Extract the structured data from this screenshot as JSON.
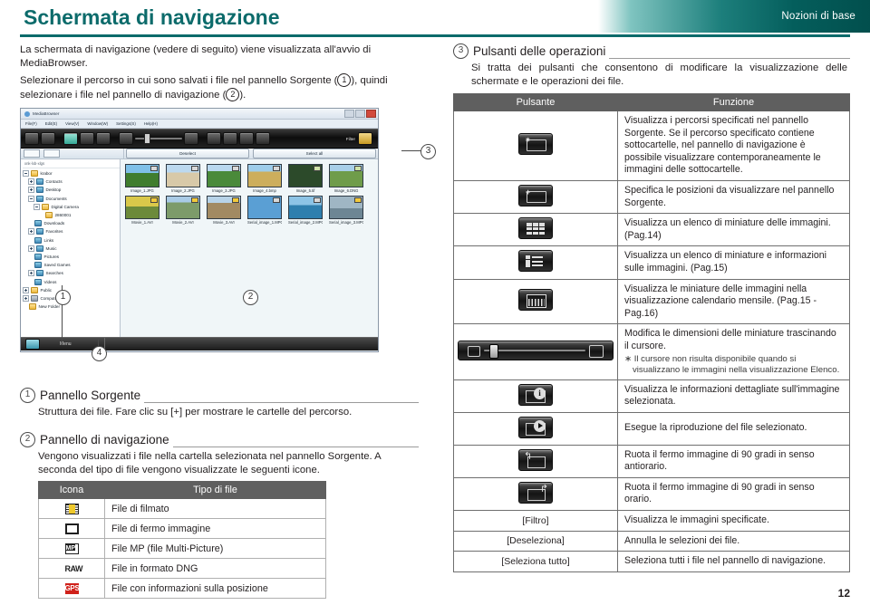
{
  "header": {
    "title": "Schermata di navigazione",
    "banner_label": "Nozioni di base"
  },
  "page_number": "12",
  "left": {
    "intro": {
      "p1": "La schermata di navigazione (vedere di seguito) viene visualizzata all'avvio di MediaBrowser.",
      "p2_a": "Selezionare il percorso in cui sono salvati i file nel pannello Sorgente (",
      "p2_mark1": "1",
      "p2_b": "), quindi selezionare i file nel pannello di navigazione (",
      "p2_mark2": "2",
      "p2_c": ")."
    },
    "callouts": {
      "one": "1",
      "two": "2",
      "three": "3",
      "four": "4"
    },
    "section1": {
      "num": "1",
      "title": "Pannello Sorgente",
      "body": "Struttura dei file. Fare clic su [+] per mostrare le cartelle del percorso."
    },
    "section2": {
      "num": "2",
      "title": "Pannello di navigazione",
      "body": "Vengono visualizzati i file nella cartella selezionata nel pannello Sorgente. A seconda del tipo di file vengono visualizzate le seguenti icone.",
      "table": {
        "headers": [
          "Icona",
          "Tipo di file"
        ],
        "rows": [
          {
            "icon": "movie-file-icon",
            "label": "File di filmato"
          },
          {
            "icon": "still-image-file-icon",
            "label": "File di fermo immagine"
          },
          {
            "icon": "mp-file-icon",
            "label": "File MP (file Multi-Picture)"
          },
          {
            "icon": "raw-dng-file-icon",
            "label": "File in formato DNG"
          },
          {
            "icon": "gps-file-icon",
            "label": "File con informazioni sulla posizione"
          }
        ]
      }
    }
  },
  "right": {
    "section3": {
      "num": "3",
      "title": "Pulsanti delle operazioni",
      "body": "Si tratta dei pulsanti che consentono di modificare la visualizzazione delle schermate e le operazioni dei file."
    },
    "table": {
      "headers": [
        "Pulsante",
        "Funzione"
      ],
      "rows": [
        {
          "button_kind": "icon",
          "button_icon": "folder-star-icon",
          "button_label": "",
          "function": "Visualizza i percorsi specificati nel pannello Sorgente. Se il percorso specificato contiene sottocartelle, nel pannello di navigazione è possibile visualizzare  contemporaneamente le immagini delle sottocartelle.",
          "note": ""
        },
        {
          "button_kind": "icon",
          "button_icon": "folder-plus-icon",
          "button_label": "",
          "function": "Specifica le posizioni da visualizzare nel pannello Sorgente.",
          "note": ""
        },
        {
          "button_kind": "icon",
          "button_icon": "thumbnail-grid-icon",
          "button_label": "",
          "function": "Visualizza un elenco di miniature delle immagini. (Pag.14)",
          "note": ""
        },
        {
          "button_kind": "icon",
          "button_icon": "thumbnail-list-icon",
          "button_label": "",
          "function": "Visualizza un elenco di miniature e informazioni sulle immagini. (Pag.15)",
          "note": ""
        },
        {
          "button_kind": "icon",
          "button_icon": "calendar-view-icon",
          "button_label": "",
          "function": "Visualizza le miniature delle immagini nella visualizzazione calendario mensile. (Pag.15 - Pag.16)",
          "note": ""
        },
        {
          "button_kind": "slider",
          "button_icon": "thumbnail-size-slider",
          "button_label": "",
          "function": "Modifica le dimensioni delle miniature trascinando il cursore.",
          "note": "∗ Il cursore non risulta disponibile quando si visualizzano le immagini nella visualizzazione Elenco."
        },
        {
          "button_kind": "icon",
          "button_icon": "image-info-icon",
          "button_label": "",
          "function": "Visualizza le informazioni dettagliate sull'immagine selezionata.",
          "note": ""
        },
        {
          "button_kind": "icon",
          "button_icon": "play-icon",
          "button_label": "",
          "function": "Esegue la riproduzione del file selezionato.",
          "note": ""
        },
        {
          "button_kind": "icon",
          "button_icon": "rotate-left-icon",
          "button_label": "",
          "function": "Ruota il fermo immagine di 90 gradi in senso antiorario.",
          "note": ""
        },
        {
          "button_kind": "icon",
          "button_icon": "rotate-right-icon",
          "button_label": "",
          "function": "Ruota il fermo immagine di 90 gradi in senso orario.",
          "note": ""
        },
        {
          "button_kind": "text",
          "button_icon": "",
          "button_label": "[Filtro]",
          "function": "Visualizza le immagini specificate.",
          "note": ""
        },
        {
          "button_kind": "text",
          "button_icon": "",
          "button_label": "[Deseleziona]",
          "function": "Annulla le selezioni dei file.",
          "note": ""
        },
        {
          "button_kind": "text",
          "button_icon": "",
          "button_label": "[Seleziona tutto]",
          "function": "Seleziona tutti i file nel pannello di navigazione.",
          "note": ""
        }
      ]
    }
  },
  "app": {
    "window_title": "MediaBrowser",
    "menu": [
      "File(F)",
      "Edit(E)",
      "View(V)",
      "Window(W)",
      "Settings(S)",
      "Help(H)"
    ],
    "toolbar": {
      "filter_label": "Filter",
      "deselect_label": "Deselect",
      "select_all_label": "Select all"
    },
    "tree": {
      "header": "xnk-lxb-xlgs",
      "nodes": [
        {
          "label": "krabor",
          "indent": 0,
          "toggle": "minus",
          "icon": "folder-icon"
        },
        {
          "label": "Contacts",
          "indent": 1,
          "toggle": "plus",
          "icon": "file-icon"
        },
        {
          "label": "Desktop",
          "indent": 1,
          "toggle": "plus",
          "icon": "file-icon"
        },
        {
          "label": "Documents",
          "indent": 1,
          "toggle": "minus",
          "icon": "file-icon"
        },
        {
          "label": "Digital Camera",
          "indent": 2,
          "toggle": "minus",
          "icon": "folder-icon"
        },
        {
          "label": "2860001",
          "indent": 3,
          "toggle": "none",
          "icon": "folder-icon"
        },
        {
          "label": "Downloads",
          "indent": 1,
          "toggle": "none",
          "icon": "file-icon"
        },
        {
          "label": "Favorites",
          "indent": 1,
          "toggle": "plus",
          "icon": "file-icon"
        },
        {
          "label": "Links",
          "indent": 1,
          "toggle": "none",
          "icon": "file-icon"
        },
        {
          "label": "Music",
          "indent": 1,
          "toggle": "plus",
          "icon": "file-icon"
        },
        {
          "label": "Pictures",
          "indent": 1,
          "toggle": "none",
          "icon": "file-icon"
        },
        {
          "label": "Saved Games",
          "indent": 1,
          "toggle": "none",
          "icon": "file-icon"
        },
        {
          "label": "Searches",
          "indent": 1,
          "toggle": "plus",
          "icon": "file-icon"
        },
        {
          "label": "Videos",
          "indent": 1,
          "toggle": "none",
          "icon": "file-icon"
        },
        {
          "label": "Public",
          "indent": 0,
          "toggle": "plus",
          "icon": "folder-icon"
        },
        {
          "label": "Computer",
          "indent": 0,
          "toggle": "plus",
          "icon": "computer-icon"
        },
        {
          "label": "New Folder",
          "indent": 0,
          "toggle": "none",
          "icon": "folder-icon"
        }
      ]
    },
    "thumbnails": [
      {
        "name": "Image_1.JPG",
        "badge": "still",
        "swatch": "p1"
      },
      {
        "name": "Image_2.JPG",
        "badge": "still",
        "swatch": "p2"
      },
      {
        "name": "Image_3.JPG",
        "badge": "still",
        "swatch": "p3"
      },
      {
        "name": "Image_4.bmp",
        "badge": "still",
        "swatch": "p4"
      },
      {
        "name": "Image_5.tif",
        "badge": "green",
        "swatch": "p5"
      },
      {
        "name": "Image_6.DNG",
        "badge": "green",
        "swatch": "p6"
      },
      {
        "name": "Movie_1.AVI",
        "badge": "movie",
        "swatch": "p7"
      },
      {
        "name": "Movie_2.AVI",
        "badge": "movie",
        "swatch": "p8"
      },
      {
        "name": "Movie_3.AVI",
        "badge": "movie",
        "swatch": "p9"
      },
      {
        "name": "Serial_image_1.MPO",
        "badge": "still",
        "swatch": "p10"
      },
      {
        "name": "Serial_image_2.MPO",
        "badge": "still",
        "swatch": "p11"
      },
      {
        "name": "Serial_image_3.MPO",
        "badge": "movie",
        "swatch": "p12"
      }
    ],
    "statusbar": {
      "menu_label": "Menu"
    }
  }
}
